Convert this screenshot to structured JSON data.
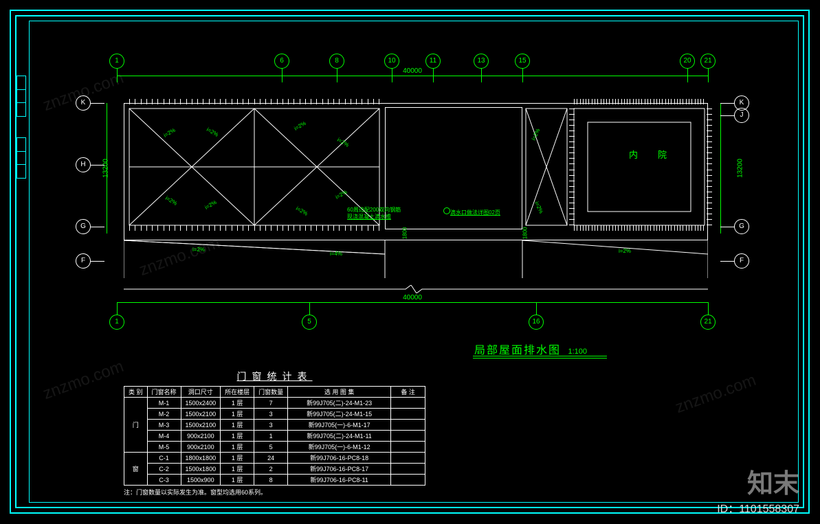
{
  "frame": {
    "drawing_title": "局部屋面排水图",
    "scale": "1:100",
    "brand": "知末",
    "id_label": "ID：1101558307",
    "watermark": "znzmo.com"
  },
  "grid": {
    "top_bubbles": [
      "1",
      "6",
      "8",
      "10",
      "11",
      "13",
      "15",
      "20",
      "21"
    ],
    "bottom_bubbles": [
      "1",
      "5",
      "16",
      "21"
    ],
    "left_bubbles": [
      "K",
      "H",
      "G",
      "F"
    ],
    "right_bubbles": [
      "K",
      "J",
      "G",
      "F"
    ]
  },
  "dimensions": {
    "top_overall": "40000",
    "bottom_overall": "40000",
    "left_overall": "13200",
    "right_overall": "13200",
    "small_1": "1800",
    "small_2": "1800"
  },
  "labels": {
    "courtyard": "内　院",
    "note1": "60周边配200双向钢筋",
    "note1b": "现浇混凝土滴水檐",
    "note2": "滴水口做法详图02页",
    "slope": "i=2%"
  },
  "table": {
    "title": "门窗统计表",
    "headers": [
      "类 别",
      "门窗名称",
      "洞口尺寸",
      "所在楼层",
      "门窗数量",
      "选 用 图 集",
      "备  注"
    ],
    "groups": [
      {
        "group": "门",
        "rows": [
          {
            "name": "M-1",
            "size": "1500x2400",
            "floor": "1 层",
            "qty": "7",
            "atlas": "新99J705(二)-24-M1-23",
            "remark": ""
          },
          {
            "name": "M-2",
            "size": "1500x2100",
            "floor": "1 层",
            "qty": "3",
            "atlas": "新99J705(二)-24-M1-15",
            "remark": ""
          },
          {
            "name": "M-3",
            "size": "1500x2100",
            "floor": "1 层",
            "qty": "3",
            "atlas": "新99J705(一)-6-M1-17",
            "remark": ""
          },
          {
            "name": "M-4",
            "size": "900x2100",
            "floor": "1 层",
            "qty": "1",
            "atlas": "新99J705(二)-24-M1-11",
            "remark": ""
          },
          {
            "name": "M-5",
            "size": "900x2100",
            "floor": "1 层",
            "qty": "5",
            "atlas": "新99J705(一)-6-M1-12",
            "remark": ""
          }
        ]
      },
      {
        "group": "窗",
        "rows": [
          {
            "name": "C-1",
            "size": "1800x1800",
            "floor": "1 层",
            "qty": "24",
            "atlas": "新99J706-16-PC8-18",
            "remark": ""
          },
          {
            "name": "C-2",
            "size": "1500x1800",
            "floor": "1 层",
            "qty": "2",
            "atlas": "新99J706-16-PC8-17",
            "remark": ""
          },
          {
            "name": "C-3",
            "size": "1500x900",
            "floor": "1 层",
            "qty": "8",
            "atlas": "新99J706-16-PC8-11",
            "remark": ""
          }
        ]
      }
    ],
    "note": "注：门窗数量以实际发生为准。窗型均选用60系列。"
  },
  "chart_data": null
}
